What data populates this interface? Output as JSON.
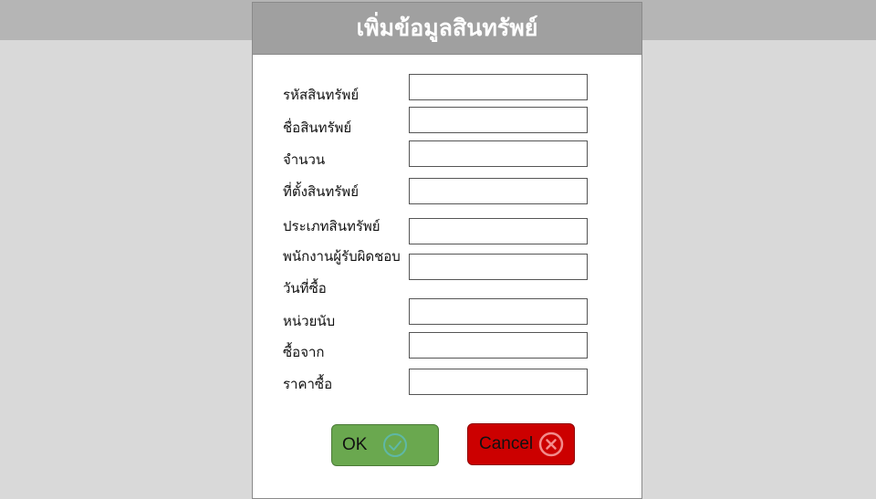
{
  "dialog": {
    "title": "เพิ่มข้อมูลสินทรัพย์",
    "fields": [
      {
        "label": "รหัสสินทรัพย์",
        "value": ""
      },
      {
        "label": "ชื่อสินทรัพย์",
        "value": ""
      },
      {
        "label": "จำนวน",
        "value": ""
      },
      {
        "label": "ที่ตั้งสินทรัพย์",
        "value": ""
      },
      {
        "label": "ประเภทสินทรัพย์",
        "value": ""
      },
      {
        "label": "พนักงานผู้รับผิดชอบ",
        "value": ""
      },
      {
        "label": "วันที่ซื้อ",
        "value": ""
      },
      {
        "label": "หน่วยนับ",
        "value": ""
      },
      {
        "label": "ซื้อจาก",
        "value": ""
      },
      {
        "label": "ราคาซื้อ",
        "value": ""
      }
    ],
    "ok_label": "OK",
    "cancel_label": "Cancel",
    "ok_icon": "check-circle-icon",
    "cancel_icon": "x-circle-icon"
  },
  "colors": {
    "background": "#d9d9d9",
    "top_strip": "#b5b5b5",
    "header": "#a0a0a0",
    "ok": "#6aa84f",
    "cancel": "#cc0000"
  }
}
